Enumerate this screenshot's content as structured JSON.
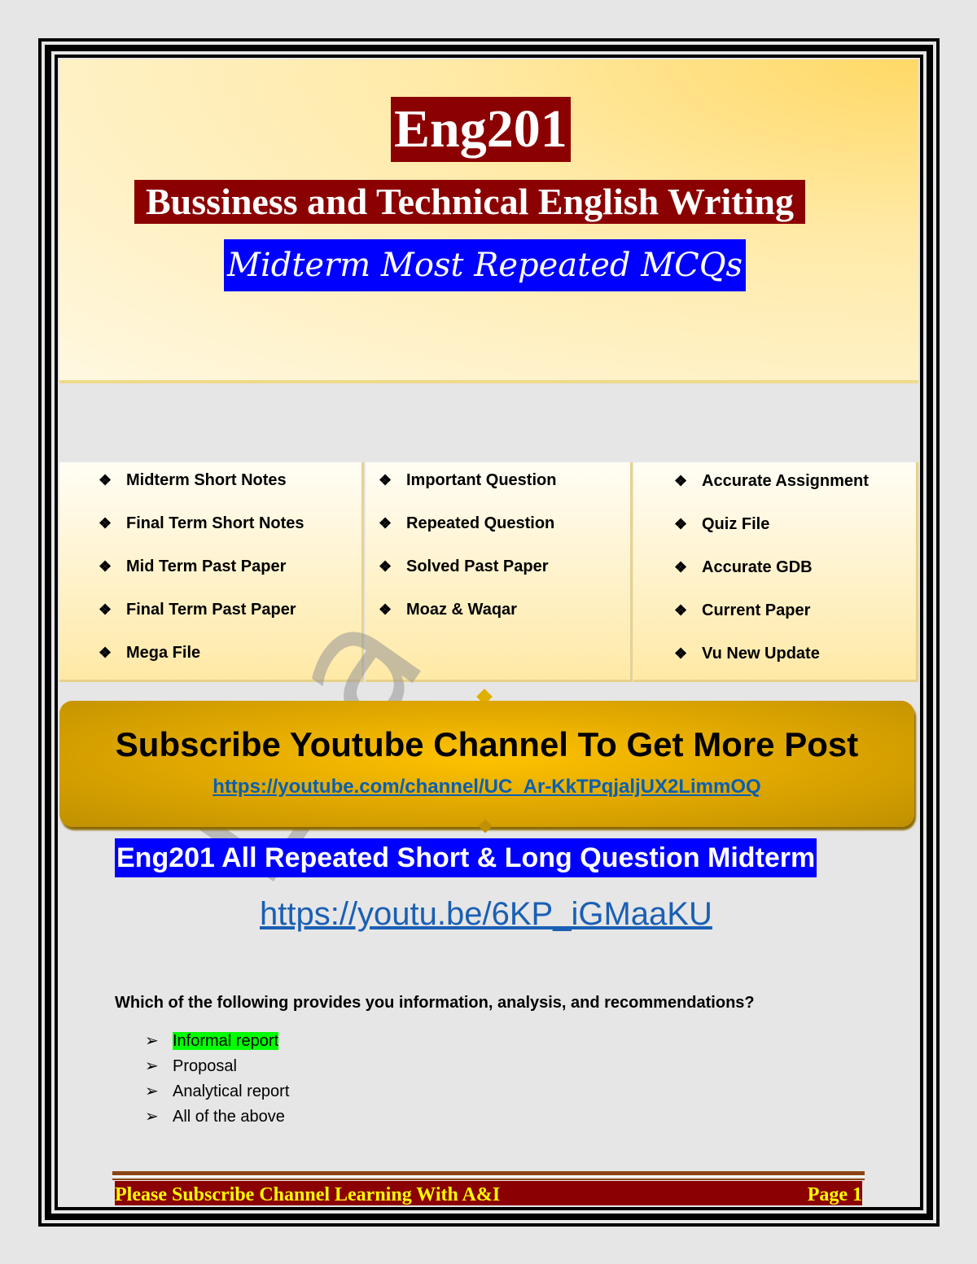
{
  "header": {
    "course": "Eng201",
    "title": "Bussiness and Technical English Writing",
    "subtitle": "Midterm Most Repeated MCQs"
  },
  "columns": [
    [
      "Midterm Short Notes",
      "Final Term Short Notes",
      "Mid Term Past Paper",
      "Final Term Past Paper",
      "Mega File"
    ],
    [
      "Important Question",
      "Repeated Question",
      "Solved Past Paper",
      "Moaz & Waqar"
    ],
    [
      "Accurate Assignment",
      "Quiz File",
      "Accurate GDB",
      "Current Paper",
      "Vu New Update"
    ]
  ],
  "subscribe": {
    "heading": "Subscribe Youtube Channel To Get More Post",
    "link": "https://youtube.com/channel/UC_Ar-KkTPqjaljUX2LimmOQ"
  },
  "promo": {
    "title": "Eng201 All Repeated Short & Long Question Midterm",
    "link": "https://youtu.be/6KP_iGMaaKU"
  },
  "watermark": "Lea",
  "question": {
    "text": "Which of the following provides you information, analysis, and recommendations?",
    "options": [
      "Informal report",
      "Proposal",
      "Analytical report",
      "All of the above"
    ],
    "highlighted_option": 0,
    "highlight_color": "#00ff00"
  },
  "footer": {
    "left": "Please Subscribe Channel Learning With A&I",
    "right": "Page 1"
  }
}
